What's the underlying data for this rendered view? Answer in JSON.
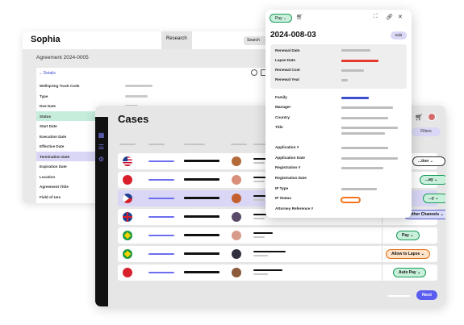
{
  "sophia_window": {
    "brand": "Sophia",
    "research_tab": "Research",
    "search_label": "Search",
    "agreement": "Agreement 2024-0005",
    "details_label": "Details",
    "fields": [
      {
        "label": "Wellspring Track Code"
      },
      {
        "label": "Type"
      },
      {
        "label": "Due Date"
      },
      {
        "label": "Status"
      },
      {
        "label": "Start Date"
      },
      {
        "label": "Execution Date"
      },
      {
        "label": "Effective Date"
      },
      {
        "label": "Termination Date"
      },
      {
        "label": "Expiration Date"
      },
      {
        "label": "Location"
      },
      {
        "label": "Agreement Titile"
      },
      {
        "label": "Field of Use"
      }
    ]
  },
  "cases_window": {
    "title": "Cases",
    "filters_label": "Filters",
    "next_label": "Next",
    "rows": [
      {
        "flag": "us",
        "action": "...tion",
        "action_style": "white"
      },
      {
        "flag": "hk",
        "action": "...ay",
        "action_style": "green"
      },
      {
        "flag": "ph",
        "action": "...y",
        "action_style": "green"
      },
      {
        "flag": "uk",
        "action": "Other Channels",
        "action_style": "blue"
      },
      {
        "flag": "br",
        "action": "Pay",
        "action_style": "green"
      },
      {
        "flag": "br",
        "action": "Allow to Lapse",
        "action_style": "orange"
      },
      {
        "flag": "hk",
        "action": "Auto Pay",
        "action_style": "green"
      }
    ]
  },
  "detail_window": {
    "pay_tag": "Pay",
    "date": "2024-008-03",
    "edit_label": "Edit",
    "renewal_fields": [
      "Renewal Date",
      "Lapse Date",
      "Renewal Cost",
      "Renewal Year"
    ],
    "fields": [
      "Family",
      "Manager",
      "Country",
      "Title",
      "Application #",
      "Application Date",
      "Registration #",
      "Registration Date",
      "IP Type",
      "IP Status",
      "Attorney Reference #"
    ]
  },
  "colors": {
    "accent": "#5a5df0",
    "green_pill": "#c8f0da",
    "orange_pill": "#ffe3c8",
    "blue_pill": "#d9dcfb",
    "selected_row": "#d9d7f5",
    "lapse_red": "#e23a2f",
    "status_orange": "#f07419"
  },
  "icons": [
    "cart-icon",
    "expand-icon",
    "link-icon",
    "close-icon",
    "grid-icon",
    "list-icon",
    "settings-icon",
    "chevron-down-icon"
  ]
}
